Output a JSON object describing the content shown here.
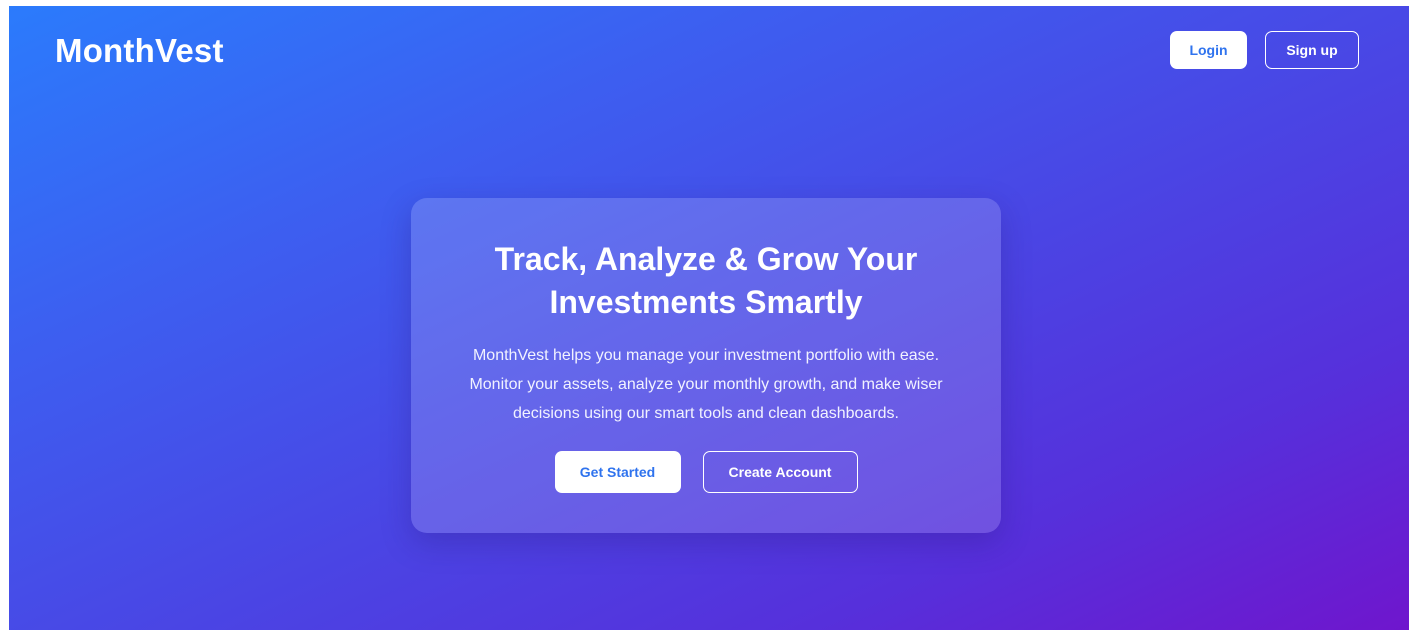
{
  "header": {
    "brand": "MonthVest",
    "login_label": "Login",
    "signup_label": "Sign up"
  },
  "hero": {
    "title_line1": "Track, Analyze & Grow Your",
    "title_line2": "Investments Smartly",
    "description_line1": "MonthVest helps you manage your investment portfolio with ease.",
    "description_line2": "Monitor your assets, analyze your monthly growth, and make wiser",
    "description_line3": "decisions using our smart tools and clean dashboards.",
    "primary_cta": "Get Started",
    "secondary_cta": "Create Account"
  },
  "colors": {
    "gradient_start": "#2b7bfc",
    "gradient_end": "#6f16cd",
    "button_text_accent": "#2f73ee"
  }
}
